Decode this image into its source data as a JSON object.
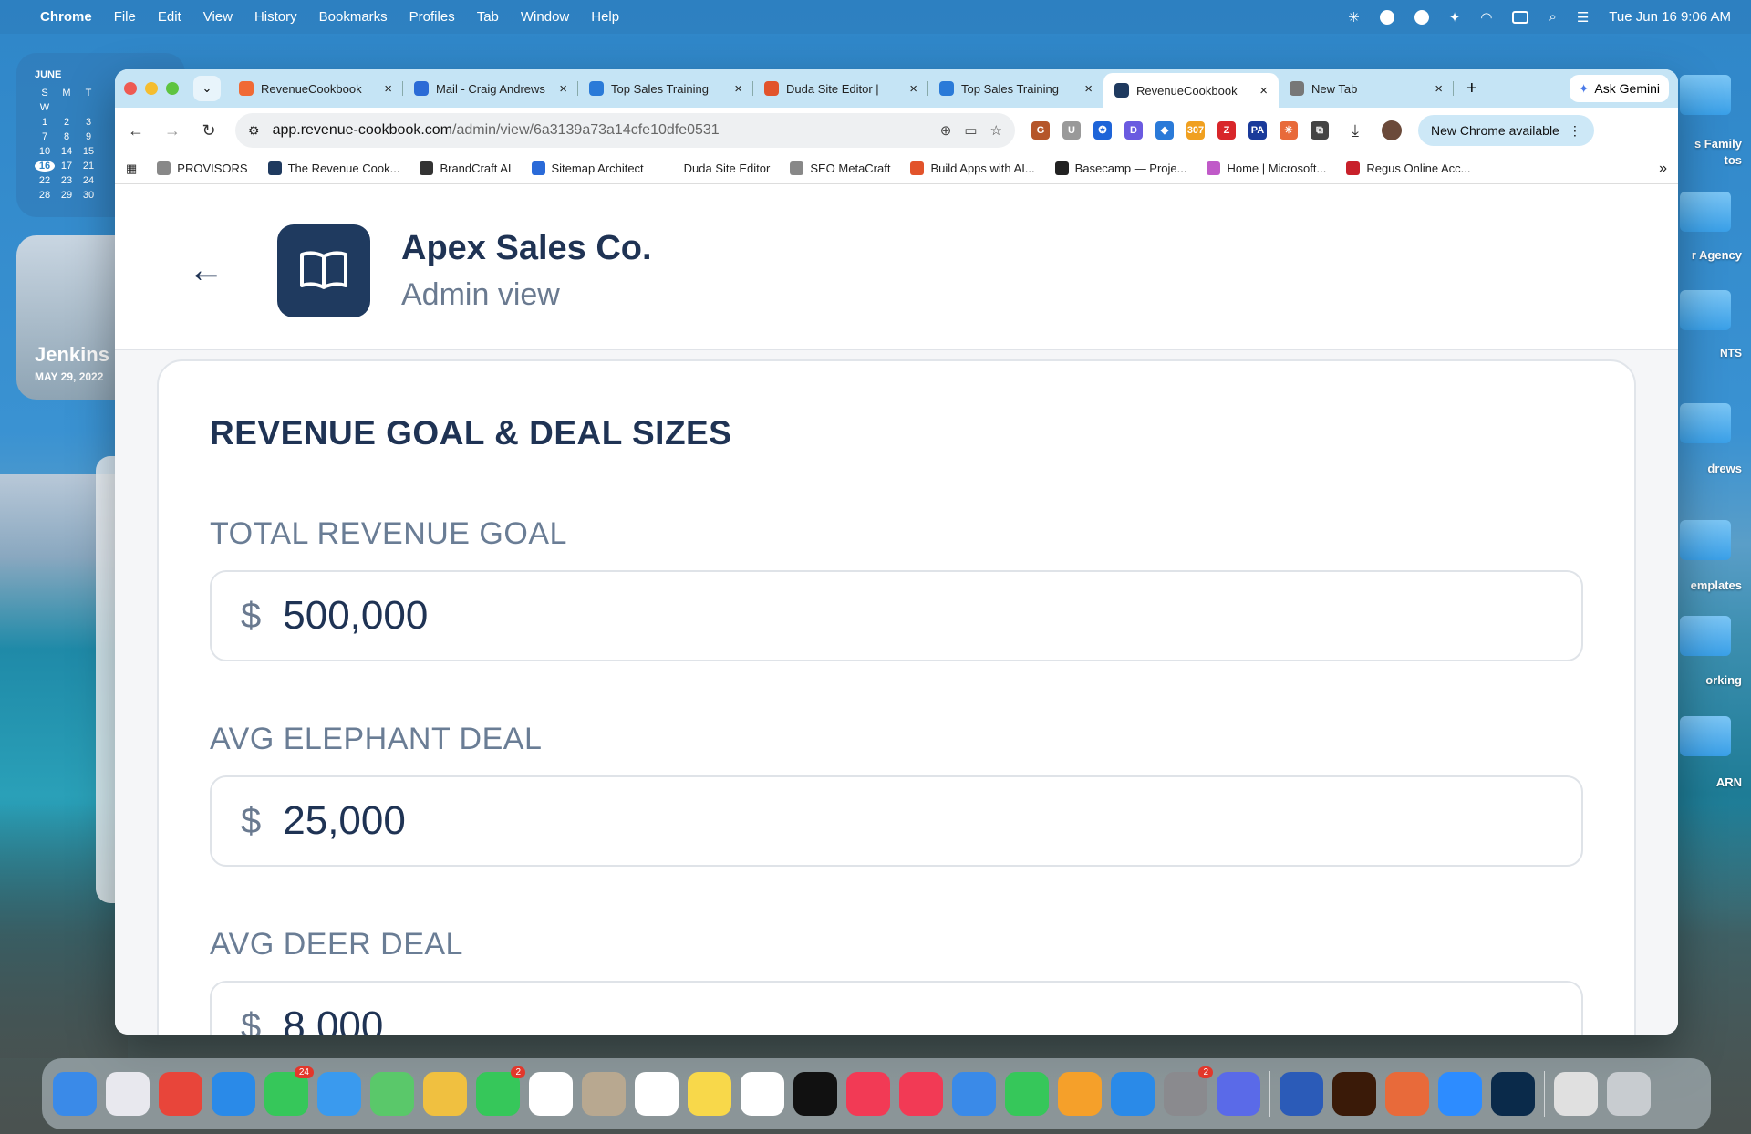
{
  "menubar": {
    "app": "Chrome",
    "items": [
      "File",
      "Edit",
      "View",
      "History",
      "Bookmarks",
      "Profiles",
      "Tab",
      "Window",
      "Help"
    ],
    "clock": "Tue Jun 16  9:06 AM"
  },
  "calendar": {
    "month": "JUNE",
    "days": [
      "S",
      "M",
      "T",
      "W",
      "",
      "",
      "1",
      "2",
      "3",
      "7",
      "8",
      "9",
      "10",
      "14",
      "15",
      "16",
      "17",
      "21",
      "22",
      "23",
      "24",
      "28",
      "29",
      "30"
    ],
    "today": "16"
  },
  "photo": {
    "name": "Jenkins",
    "date": "MAY 29, 2022"
  },
  "desktop": {
    "labels": [
      "s Family",
      "tos",
      "r Agency",
      "NTS",
      "drews",
      "emplates",
      "orking",
      "ARN"
    ]
  },
  "tabs": [
    {
      "title": "RevenueCookbook",
      "color": "#f06a35"
    },
    {
      "title": "Mail - Craig Andrews",
      "color": "#2b6bd6"
    },
    {
      "title": "Top Sales Training",
      "color": "#2a7ad8"
    },
    {
      "title": "Duda Site Editor | ",
      "color": "#e2532b"
    },
    {
      "title": "Top Sales Training",
      "color": "#2a7ad8"
    },
    {
      "title": "RevenueCookbook",
      "color": "#1f3a5f",
      "active": true
    },
    {
      "title": "New Tab",
      "color": "#777"
    }
  ],
  "gemini": "Ask Gemini",
  "url": {
    "host": "app.revenue-cookbook.com",
    "path": "/admin/view/6a3139a73a14cfe10dfe0531"
  },
  "extensions": [
    {
      "label": "G",
      "color": "#b5562a"
    },
    {
      "label": "U",
      "color": "#999"
    },
    {
      "label": "✪",
      "color": "#1e64d8"
    },
    {
      "label": "D",
      "color": "#6a5ae0"
    },
    {
      "label": "◆",
      "color": "#2a7ad8"
    },
    {
      "label": "307",
      "color": "#f0a020"
    },
    {
      "label": "Z",
      "color": "#d8262a"
    },
    {
      "label": "PA",
      "color": "#1a3a9a"
    },
    {
      "label": "✳",
      "color": "#e86a3a"
    },
    {
      "label": "⧉",
      "color": "#444"
    }
  ],
  "update": "New Chrome available",
  "bookmarks": [
    {
      "label": "PROVISORS",
      "color": "#888"
    },
    {
      "label": "The Revenue Cook...",
      "color": "#1f3a5f"
    },
    {
      "label": "BrandCraft AI",
      "color": "#333"
    },
    {
      "label": "Sitemap Architect",
      "color": "#2a6ad8"
    },
    {
      "label": "Duda Site Editor",
      "color": "#fff"
    },
    {
      "label": "SEO MetaCraft",
      "color": "#888"
    },
    {
      "label": "Build Apps with AI...",
      "color": "#e2532b"
    },
    {
      "label": "Basecamp — Proje...",
      "color": "#222"
    },
    {
      "label": "Home | Microsoft...",
      "color": "#c05ac8"
    },
    {
      "label": "Regus Online Acc...",
      "color": "#c8202a"
    }
  ],
  "page": {
    "company": "Apex Sales Co.",
    "subtitle": "Admin view",
    "section": "REVENUE GOAL & DEAL SIZES",
    "fields": [
      {
        "label": "TOTAL REVENUE GOAL",
        "currency": "$",
        "value": "500,000"
      },
      {
        "label": "AVG ELEPHANT DEAL",
        "currency": "$",
        "value": "25,000"
      },
      {
        "label": "AVG DEER DEAL",
        "currency": "$",
        "value": "8,000"
      }
    ]
  },
  "dock": [
    {
      "name": "finder",
      "color": "#3a8ae8"
    },
    {
      "name": "launchpad",
      "color": "#e8e8ee"
    },
    {
      "name": "chrome",
      "color": "#e8453a"
    },
    {
      "name": "safari",
      "color": "#2a8ae8"
    },
    {
      "name": "messages",
      "color": "#36c75a",
      "badge": "24"
    },
    {
      "name": "mail",
      "color": "#3a9aee"
    },
    {
      "name": "maps",
      "color": "#5ac86a"
    },
    {
      "name": "photos",
      "color": "#f0c040"
    },
    {
      "name": "facetime",
      "color": "#36c75a",
      "badge": "2"
    },
    {
      "name": "calendar",
      "color": "#fff"
    },
    {
      "name": "contacts",
      "color": "#b8a890"
    },
    {
      "name": "reminders",
      "color": "#fff"
    },
    {
      "name": "notes",
      "color": "#f8d84a"
    },
    {
      "name": "freeform",
      "color": "#fff"
    },
    {
      "name": "tv",
      "color": "#111"
    },
    {
      "name": "music",
      "color": "#f23a55"
    },
    {
      "name": "news",
      "color": "#f23a55"
    },
    {
      "name": "keynote",
      "color": "#3a8ae8"
    },
    {
      "name": "numbers",
      "color": "#36c75a"
    },
    {
      "name": "pages",
      "color": "#f5a02a"
    },
    {
      "name": "app-store",
      "color": "#2a8ae8"
    },
    {
      "name": "settings",
      "color": "#8a8a8e",
      "badge": "2"
    },
    {
      "name": "simulator",
      "color": "#5a6ae8"
    },
    {
      "name": "word",
      "color": "#2b5bb8"
    },
    {
      "name": "illustrator",
      "color": "#3a1a08"
    },
    {
      "name": "claude",
      "color": "#e86a3a"
    },
    {
      "name": "zoom",
      "color": "#2d8cff"
    },
    {
      "name": "photoshop",
      "color": "#0a2a4a"
    },
    {
      "name": "music-file",
      "color": "#e0e0e0"
    },
    {
      "name": "trash",
      "color": "#c8ccd0"
    }
  ]
}
